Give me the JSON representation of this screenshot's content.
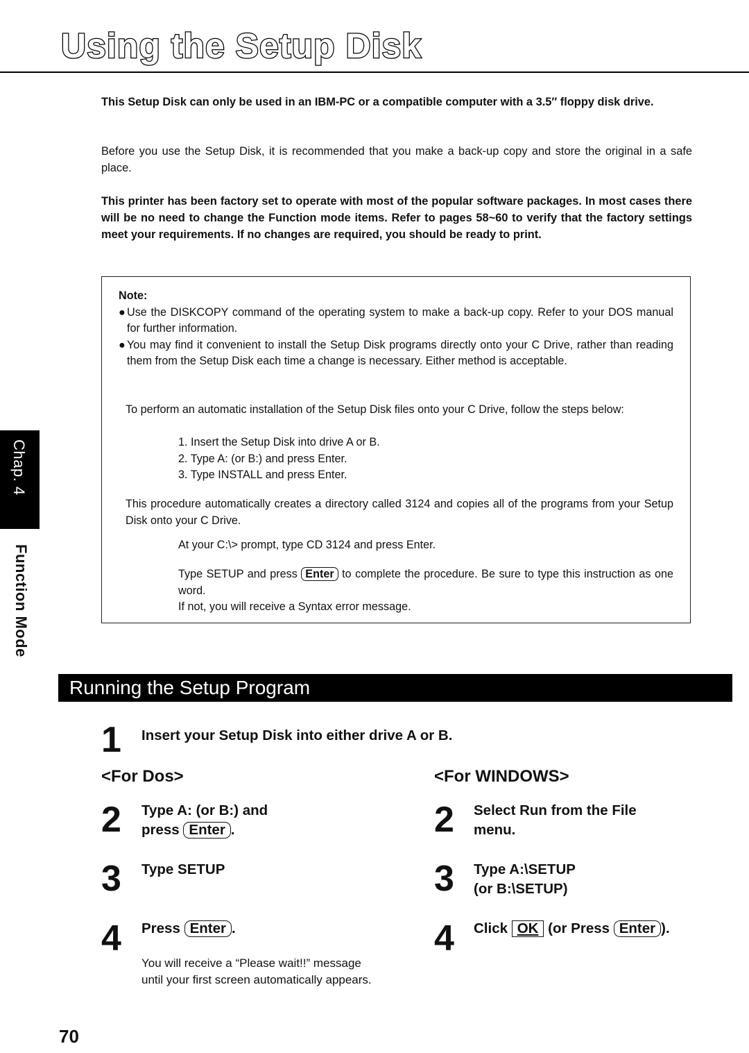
{
  "header": {
    "title": "Using the Setup Disk"
  },
  "intro": {
    "p1": "This Setup Disk can only be used in an IBM-PC or a compatible computer with a 3.5″ floppy disk drive.",
    "p2": "Before you use the Setup Disk, it is recommended that you make a back-up copy and store the original in a safe place.",
    "p3": "This printer has been factory set to operate with most of the popular software packages. In most cases there will be no need to change the Function mode items. Refer to pages 58~60 to verify that the factory settings meet your requirements. If no changes are required, you should be ready to print."
  },
  "note": {
    "label": "Note:",
    "bullet_glyph": "●",
    "bullets": [
      "Use the DISKCOPY command of the operating system to make a back-up copy. Refer to your DOS manual for further information.",
      "You may find it convenient to install the Setup Disk programs directly onto your C Drive, rather than reading them from the Setup Disk each time a change is necessary. Either method is acceptable."
    ],
    "auto_install_intro": "To perform an automatic installation of the Setup Disk files onto your C Drive, follow the steps below:",
    "steps": [
      "1.  Insert the Setup Disk into drive A or B.",
      "2.  Type A: (or B:) and press Enter.",
      "3.  Type INSTALL and press Enter."
    ],
    "procedure_text": "This procedure automatically creates a directory called 3124 and copies all of the programs from your Setup Disk onto your C Drive.",
    "cd_instruction": "At your C:\\> prompt, type CD 3124 and press Enter.",
    "setup_pre": "Type SETUP and press ",
    "setup_key": "Enter",
    "setup_post": " to complete the procedure. Be sure to type this instruction as one word.",
    "syntax_warning": "If not, you will receive a Syntax error message."
  },
  "side_tab": {
    "chapter": "Chap. 4",
    "section": "Function Mode"
  },
  "running": {
    "banner": "Running the Setup Program",
    "step1": {
      "num": "1",
      "text": "Insert your Setup Disk into either drive A or B."
    },
    "dos": {
      "heading": "<For Dos>",
      "step2": {
        "num": "2",
        "line1": "Type A: (or B:) and",
        "line2_pre": "press ",
        "key": "Enter",
        "line2_post": "."
      },
      "step3": {
        "num": "3",
        "text": "Type SETUP"
      },
      "step4": {
        "num": "4",
        "pre": "Press ",
        "key": "Enter",
        "post": ".",
        "note_line1": "You will receive a “Please wait!!” message",
        "note_line2": "until your first screen automatically appears."
      }
    },
    "windows": {
      "heading": "<For WINDOWS>",
      "step2": {
        "num": "2",
        "line1": "Select Run from the File",
        "line2": "menu."
      },
      "step3": {
        "num": "3",
        "line1": "Type A:\\SETUP",
        "line2": "(or B:\\SETUP)"
      },
      "step4": {
        "num": "4",
        "pre": "Click ",
        "ok_key": "OK",
        "mid": " (or Press ",
        "key": "Enter",
        "post": ")."
      }
    }
  },
  "footer": {
    "page_number": "70"
  }
}
